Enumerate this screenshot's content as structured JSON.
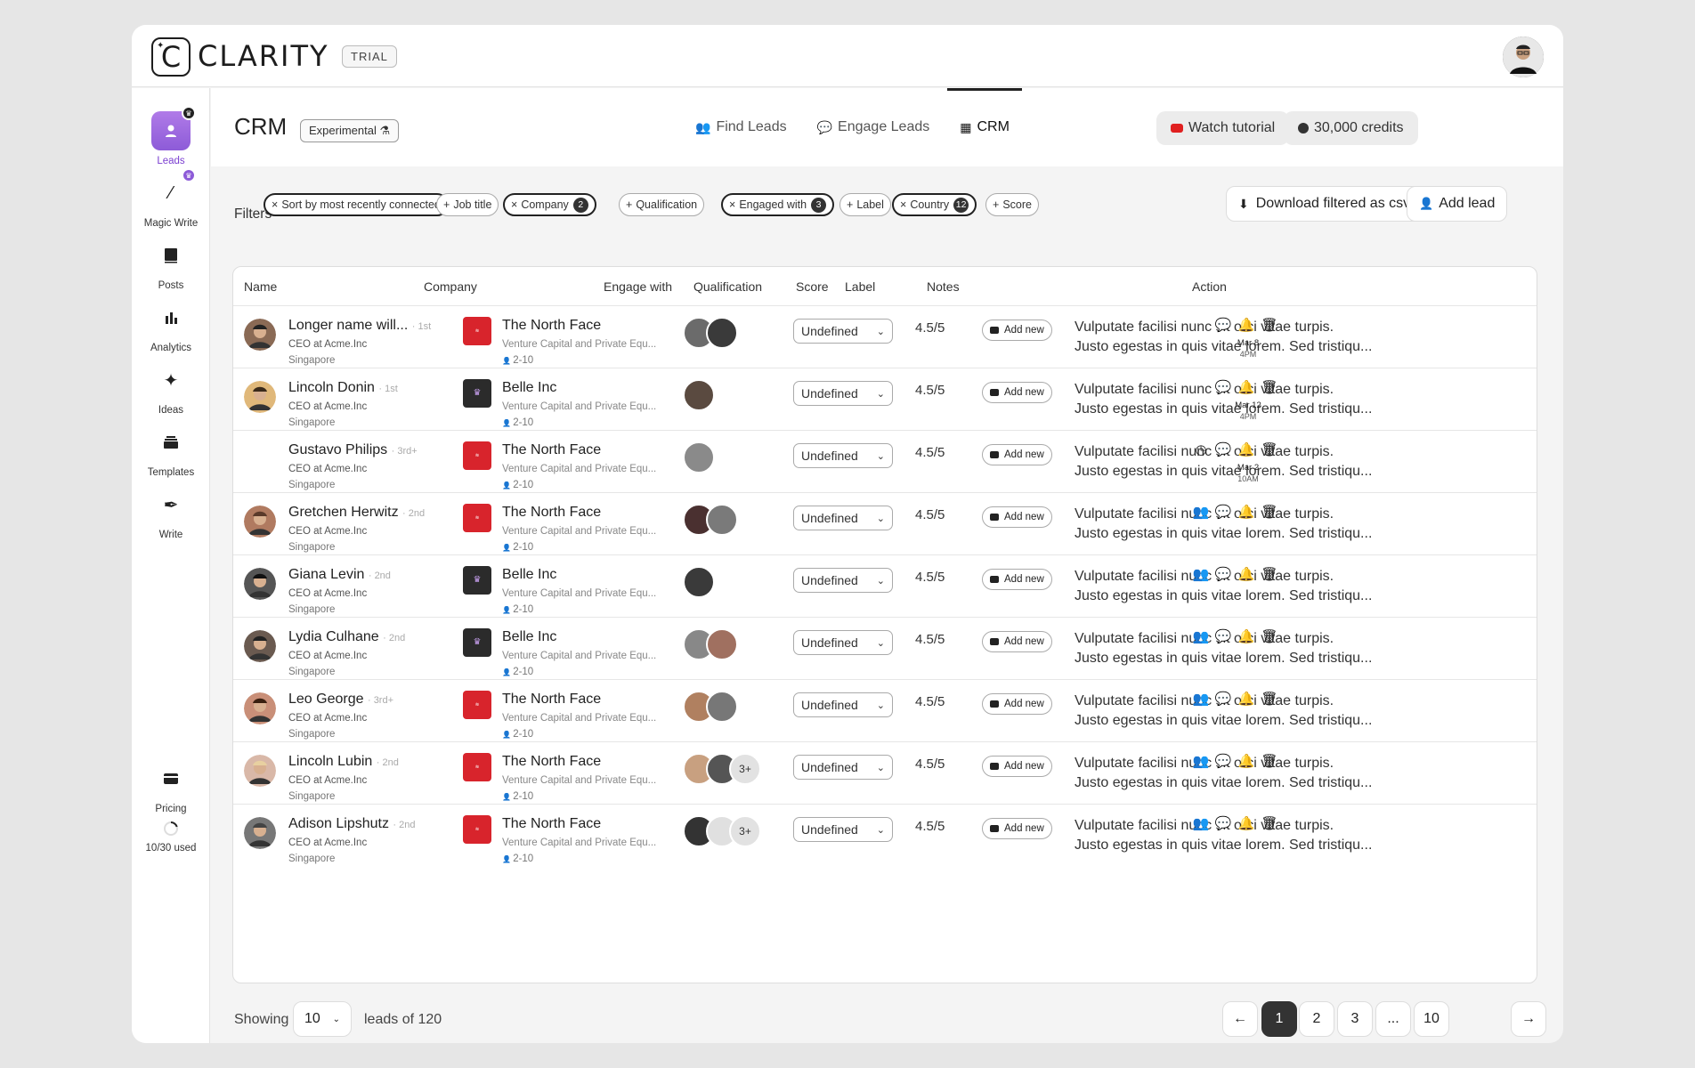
{
  "app": {
    "logo_text": "CLARITY",
    "badge": "TRIAL"
  },
  "sidebar": {
    "items": [
      {
        "label": "Leads",
        "icon": "leads-icon"
      },
      {
        "label": "Magic Write",
        "icon": "magic-wand-icon"
      },
      {
        "label": "Posts",
        "icon": "posts-icon"
      },
      {
        "label": "Analytics",
        "icon": "analytics-icon"
      },
      {
        "label": "Ideas",
        "icon": "sparkle-icon"
      },
      {
        "label": "Templates",
        "icon": "templates-icon"
      },
      {
        "label": "Write",
        "icon": "pen-icon"
      }
    ],
    "pricing": "Pricing",
    "usage": "10/30 used"
  },
  "header": {
    "title": "CRM",
    "tag": "Experimental",
    "tabs": [
      "Find Leads",
      "Engage Leads",
      "CRM"
    ],
    "active_tab": "CRM",
    "watch": "Watch tutorial",
    "credits": "30,000 credits"
  },
  "filters": {
    "label": "Filters",
    "chips": [
      {
        "label": "Sort by most recently connected",
        "prefix": "×",
        "count": ""
      },
      {
        "label": "Job title",
        "prefix": "+",
        "count": ""
      },
      {
        "label": "Company",
        "prefix": "×",
        "count": "2"
      },
      {
        "label": "Qualification",
        "prefix": "+",
        "count": ""
      },
      {
        "label": "Engaged with",
        "prefix": "×",
        "count": "3"
      },
      {
        "label": "Label",
        "prefix": "+",
        "count": ""
      },
      {
        "label": "Country",
        "prefix": "×",
        "count": "12"
      },
      {
        "label": "Score",
        "prefix": "+",
        "count": ""
      }
    ],
    "download": "Download filtered as csv",
    "add_lead": "Add lead"
  },
  "table": {
    "columns": [
      "Name",
      "Company",
      "Engage with",
      "Qualification",
      "Score",
      "Label",
      "Notes",
      "Action"
    ],
    "rows": [
      {
        "name": "Longer name will...",
        "degree": "· 1st",
        "title": "CEO at Acme.Inc",
        "location": "Singapore",
        "company": "The North Face",
        "industry": "Venture Capital and Private Equ...",
        "size": "2-10",
        "engage": 2,
        "more": "",
        "qualification": "Undefined",
        "score": "4.5/5",
        "label": "Add new",
        "note1": "Vulputate facilisi nunc sit orci vitae turpis.",
        "note2": "Justo egestas in quis vitae lorem. Sed tristiqu...",
        "actions": "scheduled",
        "date": "Mar 8",
        "time": "4PM"
      },
      {
        "name": "Lincoln Donin",
        "degree": "· 1st",
        "title": "CEO at Acme.Inc",
        "location": "Singapore",
        "company": "Belle Inc",
        "industry": "Venture Capital and Private Equ...",
        "size": "2-10",
        "engage": 1,
        "more": "",
        "qualification": "Undefined",
        "score": "4.5/5",
        "label": "Add new",
        "note1": "Vulputate facilisi nunc sit orci vitae turpis.",
        "note2": "Justo egestas in quis vitae lorem. Sed tristiqu...",
        "actions": "scheduled",
        "date": "Mar 12",
        "time": "4PM"
      },
      {
        "name": "Gustavo Philips",
        "degree": "· 3rd+",
        "title": "CEO at Acme.Inc",
        "location": "Singapore",
        "company": "The North Face",
        "industry": "Venture Capital and Private Equ...",
        "size": "2-10",
        "engage": 1,
        "more": "",
        "qualification": "Undefined",
        "score": "4.5/5",
        "label": "Add new",
        "note1": "Vulputate facilisi nunc sit orci vitae turpis.",
        "note2": "Justo egestas in quis vitae lorem. Sed tristiqu...",
        "actions": "pending",
        "date": "Mar 2",
        "time": "10AM"
      },
      {
        "name": "Gretchen Herwitz",
        "degree": "· 2nd",
        "title": "CEO at Acme.Inc",
        "location": "Singapore",
        "company": "The North Face",
        "industry": "Venture Capital and Private Equ...",
        "size": "2-10",
        "engage": 2,
        "more": "",
        "qualification": "Undefined",
        "score": "4.5/5",
        "label": "Add new",
        "note1": "Vulputate facilisi nunc sit orci vitae turpis.",
        "note2": "Justo egestas in quis vitae lorem. Sed tristiqu...",
        "actions": "full",
        "date": "",
        "time": ""
      },
      {
        "name": "Giana Levin",
        "degree": "· 2nd",
        "title": "CEO at Acme.Inc",
        "location": "Singapore",
        "company": "Belle Inc",
        "industry": "Venture Capital and Private Equ...",
        "size": "2-10",
        "engage": 1,
        "more": "",
        "qualification": "Undefined",
        "score": "4.5/5",
        "label": "Add new",
        "note1": "Vulputate facilisi nunc sit orci vitae turpis.",
        "note2": "Justo egestas in quis vitae lorem. Sed tristiqu...",
        "actions": "full",
        "date": "",
        "time": ""
      },
      {
        "name": "Lydia Culhane",
        "degree": "· 2nd",
        "title": "CEO at Acme.Inc",
        "location": "Singapore",
        "company": "Belle Inc",
        "industry": "Venture Capital and Private Equ...",
        "size": "2-10",
        "engage": 2,
        "more": "",
        "qualification": "Undefined",
        "score": "4.5/5",
        "label": "Add new",
        "note1": "Vulputate facilisi nunc sit orci vitae turpis.",
        "note2": "Justo egestas in quis vitae lorem. Sed tristiqu...",
        "actions": "full",
        "date": "",
        "time": ""
      },
      {
        "name": "Leo George",
        "degree": "· 3rd+",
        "title": "CEO at Acme.Inc",
        "location": "Singapore",
        "company": "The North Face",
        "industry": "Venture Capital and Private Equ...",
        "size": "2-10",
        "engage": 2,
        "more": "",
        "qualification": "Undefined",
        "score": "4.5/5",
        "label": "Add new",
        "note1": "Vulputate facilisi nunc sit orci vitae turpis.",
        "note2": "Justo egestas in quis vitae lorem. Sed tristiqu...",
        "actions": "full",
        "date": "",
        "time": ""
      },
      {
        "name": "Lincoln Lubin",
        "degree": "· 2nd",
        "title": "CEO at Acme.Inc",
        "location": "Singapore",
        "company": "The North Face",
        "industry": "Venture Capital and Private Equ...",
        "size": "2-10",
        "engage": 2,
        "more": "3+",
        "qualification": "Undefined",
        "score": "4.5/5",
        "label": "Add new",
        "note1": "Vulputate facilisi nunc sit orci vitae turpis.",
        "note2": "Justo egestas in quis vitae lorem. Sed tristiqu...",
        "actions": "full2",
        "date": "",
        "time": ""
      },
      {
        "name": "Adison Lipshutz",
        "degree": "· 2nd",
        "title": "CEO at Acme.Inc",
        "location": "Singapore",
        "company": "The North Face",
        "industry": "Venture Capital and Private Equ...",
        "size": "2-10",
        "engage": 2,
        "more": "3+",
        "qualification": "Undefined",
        "score": "4.5/5",
        "label": "Add new",
        "note1": "Vulputate facilisi nunc sit orci vitae turpis.",
        "note2": "Justo egestas in quis vitae lorem. Sed tristiqu...",
        "actions": "full2",
        "date": "",
        "time": ""
      }
    ]
  },
  "pagination": {
    "showing": "Showing",
    "per_page": "10",
    "leads_of": "leads of 120",
    "pages": [
      "1",
      "2",
      "3",
      "...",
      "10"
    ],
    "current": "1"
  },
  "colors": {
    "accent": "#8d5bd8",
    "tnf": "#d8242c"
  }
}
